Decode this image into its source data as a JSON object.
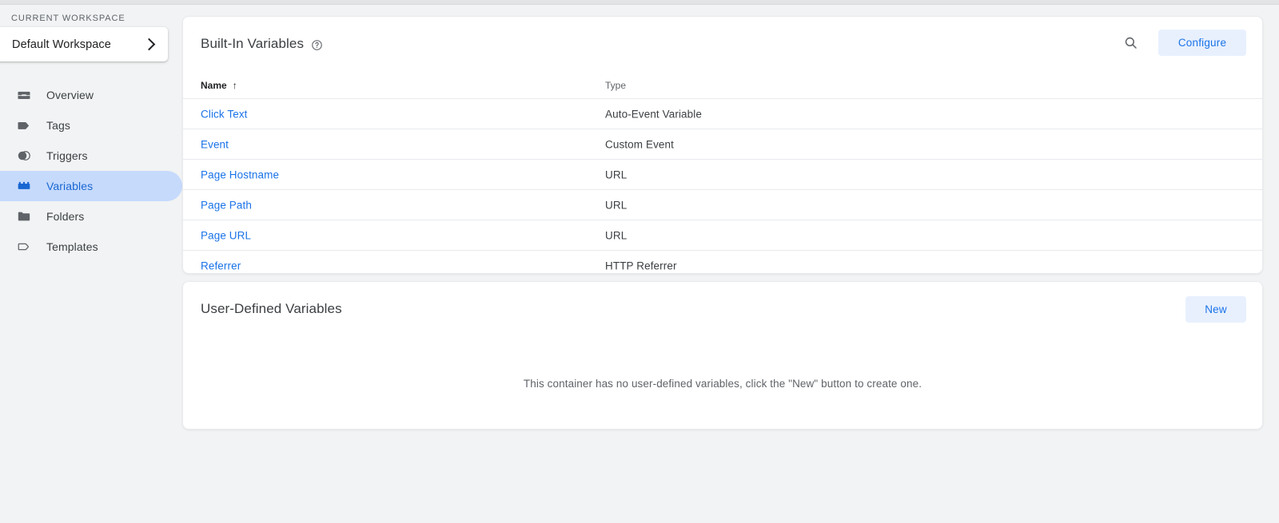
{
  "sidebar": {
    "workspace_label": "CURRENT WORKSPACE",
    "workspace_name": "Default Workspace",
    "items": [
      {
        "label": "Overview",
        "icon": "overview-icon",
        "active": false
      },
      {
        "label": "Tags",
        "icon": "tag-icon",
        "active": false
      },
      {
        "label": "Triggers",
        "icon": "trigger-icon",
        "active": false
      },
      {
        "label": "Variables",
        "icon": "variables-icon",
        "active": true
      },
      {
        "label": "Folders",
        "icon": "folder-icon",
        "active": false
      },
      {
        "label": "Templates",
        "icon": "template-icon",
        "active": false
      }
    ]
  },
  "builtin": {
    "title": "Built-In Variables",
    "help_icon": "help-circle-icon",
    "search_icon": "search-icon",
    "configure_label": "Configure",
    "columns": {
      "name": "Name",
      "sort_arrow": "↑",
      "type": "Type"
    },
    "rows": [
      {
        "name": "Click Text",
        "type": "Auto-Event Variable"
      },
      {
        "name": "Event",
        "type": "Custom Event"
      },
      {
        "name": "Page Hostname",
        "type": "URL"
      },
      {
        "name": "Page Path",
        "type": "URL"
      },
      {
        "name": "Page URL",
        "type": "URL"
      },
      {
        "name": "Referrer",
        "type": "HTTP Referrer"
      }
    ]
  },
  "userdefined": {
    "title": "User-Defined Variables",
    "new_label": "New",
    "empty_message": "This container has no user-defined variables, click the \"New\" button to create one."
  },
  "colors": {
    "page_bg": "#f1f3f4",
    "card_bg": "#ffffff",
    "link_blue": "#1a73e8",
    "active_pill": "#c6dafc",
    "active_text": "#1967d2",
    "tonal_btn_bg": "#e8f0fe",
    "text_primary": "#202124",
    "text_secondary": "#5f6368",
    "divider": "#e8eaed"
  }
}
